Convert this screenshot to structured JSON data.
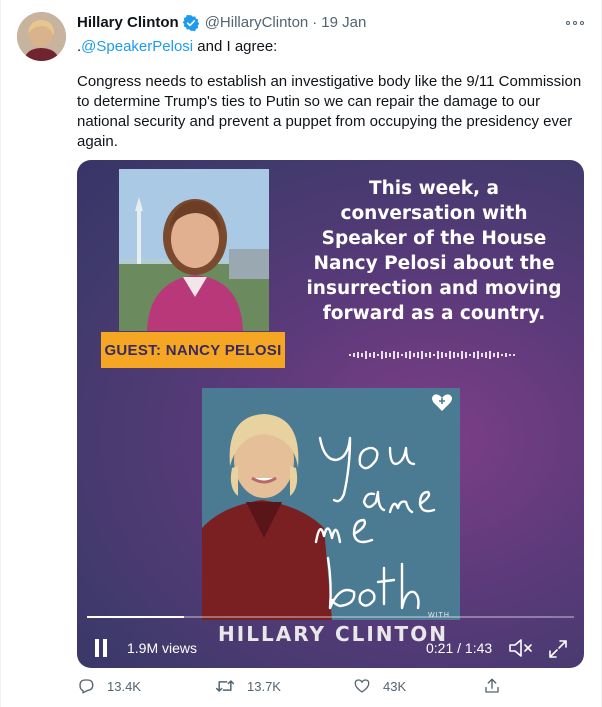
{
  "tweet": {
    "author_name": "Hillary Clinton",
    "handle": "@HillaryClinton",
    "separator": "·",
    "date": "19 Jan",
    "reply_prefix": ".",
    "mention": "@SpeakerPelosi",
    "reply_rest": " and I agree:",
    "body": "Congress needs to establish an investigative body like the 9/11 Commission\nto determine Trump's ties to Putin so we can repair the damage to our\nnational security and prevent a puppet from occupying the presidency ever\nagain."
  },
  "media": {
    "promo_text": "This week, a\nconversation with\nSpeaker of the House\nNancy Pelosi about the\ninsurrection and moving\nforward as a country.",
    "guest_label": "GUEST: NANCY PELOSI",
    "cover_title_script": "You and Me Both",
    "cover_with": "WITH",
    "cover_host": "HILLARY CLINTON",
    "views": "1.9M views",
    "time": "0:21 / 1:43",
    "progress": 0.2
  },
  "actions": {
    "replies": "13.4K",
    "retweets": "13.7K",
    "likes": "43K"
  },
  "colors": {
    "link": "#1d9bf0",
    "verified": "#1d9bf0",
    "guest_tag": "#f5a623",
    "muted_text": "#536471"
  },
  "icons": [
    "verified-badge-icon",
    "more-icon",
    "pause-icon",
    "mute-icon",
    "fullscreen-icon",
    "reply-icon",
    "retweet-icon",
    "like-icon",
    "share-icon",
    "iheart-icon"
  ]
}
